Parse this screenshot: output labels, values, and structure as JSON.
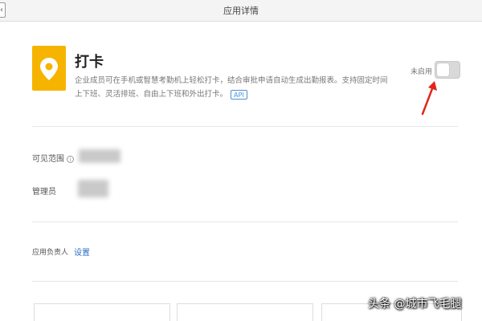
{
  "header": {
    "back_label": "‹",
    "title": "应用详情"
  },
  "app": {
    "icon": "location-pin-icon",
    "icon_color": "#f6b400",
    "name": "打卡",
    "description": "企业成员可在手机或智慧考勤机上轻松打卡，结合审批申请自动生成出勤报表。支持固定时间上下班、灵活排班、自由上下班和外出打卡。",
    "api_tag": "API"
  },
  "status": {
    "label": "未启用",
    "enabled": false
  },
  "details": {
    "visible_range_label": "可见范围",
    "admin_label": "管理员",
    "owner_label": "应用负责人",
    "owner_action": "设置"
  },
  "watermark": "头条 @城市飞毛腿",
  "colors": {
    "accent": "#2f6fbf",
    "arrow": "#e0261b"
  }
}
